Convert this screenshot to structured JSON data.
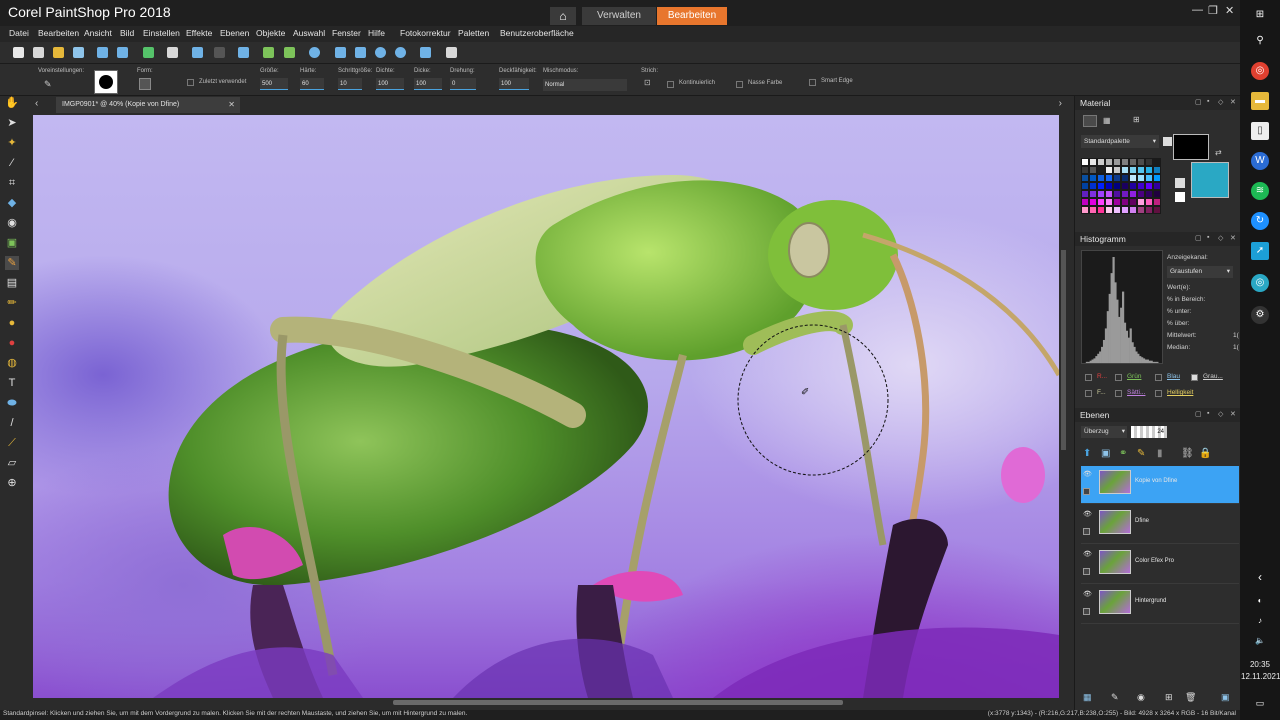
{
  "window": {
    "title": "Corel PaintShop Pro 2018",
    "home_icon": "home-icon",
    "tabs": [
      {
        "label": "Verwalten",
        "active": false
      },
      {
        "label": "Bearbeiten",
        "active": true
      }
    ],
    "accent": "#e8762d"
  },
  "menu": [
    "Datei",
    "Bearbeiten",
    "Ansicht",
    "Bild",
    "Einstellen",
    "Effekte",
    "Ebenen",
    "Objekte",
    "Auswahl",
    "Fenster",
    "Hilfe",
    "Fotokorrektur",
    "Paletten",
    "Benutzeroberfläche"
  ],
  "tool_options": {
    "presets_label": "Voreinstellungen:",
    "shape_label": "Form:",
    "recent_label": "Zuletzt verwendet",
    "size_label": "Größe:",
    "size_value": "500",
    "hardness_label": "Härte:",
    "hardness_value": "60",
    "step_label": "Schrittgröße:",
    "step_value": "10",
    "density_label": "Dichte:",
    "density_value": "100",
    "thickness_label": "Dicke:",
    "thickness_value": "100",
    "rotation_label": "Drehung:",
    "rotation_value": "0",
    "opacity_label": "Deckfähigkeit:",
    "opacity_value": "100",
    "blend_label": "Mischmodus:",
    "blend_value": "Normal",
    "stroke_label": "Strich:",
    "continuous_label": "Kontinuierlich",
    "wet_label": "Nasse Farbe",
    "smart_edge_label": "Smart Edge"
  },
  "document": {
    "tab_label": "IMGP0901* @  40% (Kopie von Dfine)"
  },
  "material": {
    "title": "Material",
    "palette": "Standardpalette",
    "foreground": "#000000",
    "background": "#2aa8c4",
    "swatches": [
      "#ffffff",
      "#e6e6e6",
      "#cccccc",
      "#b3b3b3",
      "#999999",
      "#808080",
      "#666666",
      "#4d4d4d",
      "#333333",
      "#1a1a1a",
      "#3a3a3a",
      "#555555",
      "#1e1e1e",
      "#f0f0f0",
      "#c8c8c8",
      "#a8dff5",
      "#7cd3f2",
      "#54c4ee",
      "#26b0e5",
      "#0f7fc0",
      "#0a4fa0",
      "#0058c4",
      "#1060e0",
      "#1565f5",
      "#0d3a8c",
      "#0a2d6e",
      "#bfe9ff",
      "#99e0ff",
      "#4ac0ff",
      "#0099ff",
      "#0040a0",
      "#0030d0",
      "#0020ff",
      "#0000c0",
      "#000080",
      "#1a0060",
      "#2000a0",
      "#4000d0",
      "#6000ff",
      "#3000a0",
      "#6020c0",
      "#8030e0",
      "#a040ff",
      "#c050ff",
      "#5010a0",
      "#701ac0",
      "#9020e0",
      "#4a0080",
      "#300060",
      "#200040",
      "#c000c0",
      "#e000e0",
      "#ff40ff",
      "#ff80ff",
      "#a000a0",
      "#800080",
      "#600060",
      "#ffa0e0",
      "#ff60c0",
      "#c02080",
      "#ff99cc",
      "#ff66b2",
      "#ff3399",
      "#ffccee",
      "#f0c0ff",
      "#e0a0ff",
      "#d080f0",
      "#a04080",
      "#802060",
      "#601040"
    ]
  },
  "histogram": {
    "title": "Histogramm",
    "channel_label": "Anzeigekanal:",
    "channel_value": "Graustufen",
    "stats": [
      "Wert(e):",
      "% in Bereich:",
      "% unter:",
      "% über:",
      "Mittelwert:",
      "Median:"
    ],
    "stats_values": [
      "",
      "",
      "",
      "",
      "1(",
      "1("
    ],
    "bins": [
      0,
      0,
      1,
      1,
      2,
      3,
      4,
      6,
      8,
      10,
      14,
      20,
      30,
      45,
      60,
      78,
      92,
      70,
      55,
      40,
      48,
      62,
      35,
      28,
      22,
      30,
      18,
      14,
      10,
      8,
      6,
      5,
      4,
      3,
      3,
      2,
      2,
      1,
      1,
      1,
      0,
      0
    ],
    "channels": [
      "R...",
      "Grün",
      "Blau",
      "Grau...",
      "F...",
      "Sätti...",
      "Helligkeit"
    ]
  },
  "layers": {
    "title": "Ebenen",
    "blend_mode": "Überzug",
    "opacity": "24",
    "items": [
      {
        "name": "Kopie von Dfine",
        "selected": true
      },
      {
        "name": "Dfine",
        "selected": false
      },
      {
        "name": "Color Efex Pro",
        "selected": false
      },
      {
        "name": "Hintergrund",
        "selected": false
      }
    ]
  },
  "status": {
    "left": "Standardpinsel: Klicken und ziehen Sie, um mit dem Vordergrund zu malen. Klicken Sie mit der rechten Maustaste, und ziehen Sie, um mit Hintergrund zu malen.",
    "right": "(x:3778 y:1343) - (R:216,G:217,B:238,O:255) - Bild:  4928 x 3264 x RGB - 16 Bit/Kanal"
  },
  "taskbar": {
    "time": "20:35",
    "date": "12.11.2021"
  }
}
